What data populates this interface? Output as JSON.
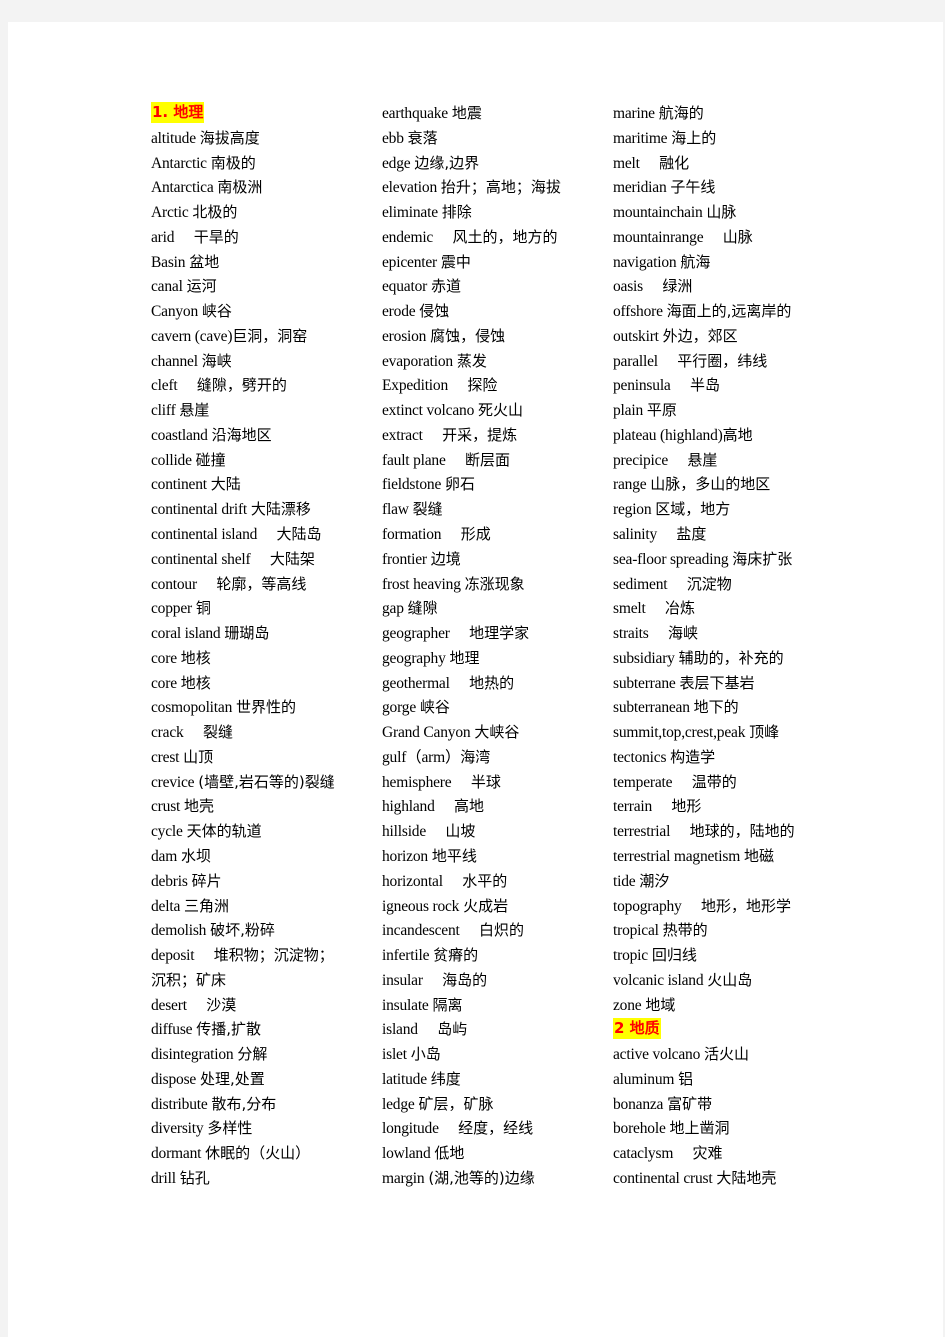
{
  "document": {
    "columns": [
      {
        "entries": [
          {
            "type": "heading",
            "text": "1.  地理"
          },
          {
            "en": "altitude",
            "zh": "海拔高度"
          },
          {
            "en": "Antarctic",
            "zh": "南极的"
          },
          {
            "en": "Antarctica",
            "zh": "南极洲"
          },
          {
            "en": "Arctic",
            "zh": "北极的"
          },
          {
            "en": "arid",
            "zh": "干旱的",
            "gap": true
          },
          {
            "en": "Basin",
            "zh": "盆地"
          },
          {
            "en": "canal",
            "zh": "运河"
          },
          {
            "en": "Canyon",
            "zh": "峡谷"
          },
          {
            "en": "cavern (cave)",
            "zh": "巨洞，洞窑",
            "tight": true
          },
          {
            "en": "channel",
            "zh": "海峡"
          },
          {
            "en": "cleft",
            "zh": "缝隙，劈开的",
            "gap": true
          },
          {
            "en": "cliff",
            "zh": "悬崖"
          },
          {
            "en": "coastland",
            "zh": "沿海地区"
          },
          {
            "en": "collide",
            "zh": "碰撞"
          },
          {
            "en": "continent",
            "zh": "大陆"
          },
          {
            "en": "continental  drift",
            "zh": "大陆漂移"
          },
          {
            "en": "continental  island",
            "zh": "大陆岛",
            "gap": true
          },
          {
            "en": "continental  shelf",
            "zh": "大陆架",
            "gap": true
          },
          {
            "en": "contour",
            "zh": "轮廓，等高线",
            "gap": true
          },
          {
            "en": "copper",
            "zh": "铜"
          },
          {
            "en": "coral  island",
            "zh": "珊瑚岛"
          },
          {
            "en": "core",
            "zh": "地核"
          },
          {
            "en": "core",
            "zh": "地核"
          },
          {
            "en": "cosmopolitan",
            "zh": "世界性的"
          },
          {
            "en": "crack",
            "zh": "裂缝",
            "gap": true
          },
          {
            "en": "crest",
            "zh": "山顶"
          },
          {
            "en": "crevice",
            "zh": "(墙壁,岩石等的)裂缝",
            "mini": true
          },
          {
            "en": "crust",
            "zh": "地壳"
          },
          {
            "en": "cycle",
            "zh": "天体的轨道"
          },
          {
            "en": "dam",
            "zh": "水坝"
          },
          {
            "en": "debris",
            "zh": "碎片"
          },
          {
            "en": "delta",
            "zh": "三角洲"
          },
          {
            "en": "demolish",
            "zh": "破坏,粉碎"
          },
          {
            "en": "deposit",
            "zh": "堆积物；沉淀物；",
            "gap": true
          },
          {
            "en": "",
            "zh": "沉积；矿床"
          },
          {
            "en": "desert",
            "zh": "沙漠",
            "gap": true
          },
          {
            "en": "diffuse",
            "zh": "传播,扩散"
          },
          {
            "en": "disintegration",
            "zh": "分解"
          },
          {
            "en": "dispose",
            "zh": "处理,处置"
          },
          {
            "en": "distribute",
            "zh": "散布,分布"
          },
          {
            "en": "diversity",
            "zh": "多样性"
          },
          {
            "en": "dormant",
            "zh": "休眠的（火山）"
          },
          {
            "en": "drill",
            "zh": "钻孔"
          }
        ]
      },
      {
        "entries": [
          {
            "en": "earthquake",
            "zh": "地震"
          },
          {
            "en": "ebb",
            "zh": "衰落"
          },
          {
            "en": "edge",
            "zh": "边缘,边界"
          },
          {
            "en": "elevation",
            "zh": "抬升；高地；海拔"
          },
          {
            "en": "eliminate",
            "zh": "排除"
          },
          {
            "en": "endemic",
            "zh": "风土的，地方的",
            "gap": true
          },
          {
            "en": "epicenter",
            "zh": "震中"
          },
          {
            "en": "equator",
            "zh": "赤道"
          },
          {
            "en": "erode",
            "zh": "侵蚀"
          },
          {
            "en": "erosion",
            "zh": "腐蚀，侵蚀"
          },
          {
            "en": "evaporation",
            "zh": "蒸发"
          },
          {
            "en": "Expedition",
            "zh": "探险",
            "gap": true
          },
          {
            "en": "extinct  volcano",
            "zh": "死火山"
          },
          {
            "en": "extract",
            "zh": "开采，提炼",
            "gap": true
          },
          {
            "en": "fault  plane",
            "zh": "断层面",
            "gap": true
          },
          {
            "en": "fieldstone",
            "zh": "卵石"
          },
          {
            "en": "flaw",
            "zh": "裂缝"
          },
          {
            "en": "formation",
            "zh": "形成",
            "gap": true
          },
          {
            "en": "frontier",
            "zh": "边境"
          },
          {
            "en": "frost  heaving",
            "zh": "冻涨现象"
          },
          {
            "en": "gap",
            "zh": "缝隙"
          },
          {
            "en": "geographer",
            "zh": "地理学家",
            "gap": true
          },
          {
            "en": "geography",
            "zh": "地理"
          },
          {
            "en": "geothermal",
            "zh": "地热的",
            "gap": true
          },
          {
            "en": "gorge",
            "zh": "峡谷"
          },
          {
            "en": "Grand  Canyon",
            "zh": "大峡谷"
          },
          {
            "en": "gulf（arm）",
            "zh": "海湾",
            "tight": true
          },
          {
            "en": "hemisphere",
            "zh": "半球",
            "gap": true
          },
          {
            "en": "highland",
            "zh": "高地",
            "gap": true
          },
          {
            "en": "hillside",
            "zh": "山坡",
            "gap": true
          },
          {
            "en": "horizon",
            "zh": "地平线"
          },
          {
            "en": "horizontal",
            "zh": "水平的",
            "gap": true
          },
          {
            "en": "igneous  rock",
            "zh": "火成岩"
          },
          {
            "en": "incandescent",
            "zh": "白炽的",
            "gap": true
          },
          {
            "en": "infertile",
            "zh": "贫瘠的"
          },
          {
            "en": "insular",
            "zh": "海岛的",
            "gap": true
          },
          {
            "en": "insulate",
            "zh": "隔离"
          },
          {
            "en": "island",
            "zh": "岛屿",
            "gap": true
          },
          {
            "en": "islet",
            "zh": "小岛"
          },
          {
            "en": "latitude",
            "zh": "纬度"
          },
          {
            "en": "ledge",
            "zh": "矿层，矿脉"
          },
          {
            "en": "longitude",
            "zh": "经度，经线",
            "gap": true
          },
          {
            "en": "lowland",
            "zh": "低地"
          },
          {
            "en": "margin",
            "zh": "(湖,池等的)边缘",
            "mini": true
          }
        ]
      },
      {
        "entries": [
          {
            "en": "marine",
            "zh": "航海的"
          },
          {
            "en": "maritime",
            "zh": "海上的"
          },
          {
            "en": "melt",
            "zh": "融化",
            "gap": true
          },
          {
            "en": "meridian",
            "zh": "子午线"
          },
          {
            "en": "mountainchain",
            "zh": "山脉"
          },
          {
            "en": "mountainrange",
            "zh": "山脉",
            "gap": true
          },
          {
            "en": "navigation",
            "zh": "航海"
          },
          {
            "en": "oasis",
            "zh": "绿洲",
            "gap": true
          },
          {
            "en": "offshore",
            "zh": "海面上的,远离岸的"
          },
          {
            "en": "outskirt",
            "zh": "外边，郊区"
          },
          {
            "en": "parallel",
            "zh": "平行圈，纬线",
            "gap": true
          },
          {
            "en": "peninsula",
            "zh": "半岛",
            "gap": true
          },
          {
            "en": "plain",
            "zh": "平原"
          },
          {
            "en": "plateau  (highland)",
            "zh": "高地",
            "tight": true
          },
          {
            "en": "precipice",
            "zh": "悬崖",
            "gap": true
          },
          {
            "en": "range",
            "zh": "山脉，多山的地区"
          },
          {
            "en": "region",
            "zh": "区域，地方"
          },
          {
            "en": "salinity",
            "zh": "盐度",
            "gap": true
          },
          {
            "en": "sea-floor  spreading",
            "zh": "海床扩张"
          },
          {
            "en": "sediment",
            "zh": "沉淀物",
            "gap": true
          },
          {
            "en": "smelt",
            "zh": "冶炼",
            "gap": true
          },
          {
            "en": "straits",
            "zh": "海峡",
            "gap": true
          },
          {
            "en": "subsidiary",
            "zh": "辅助的，补充的"
          },
          {
            "en": "subterrane",
            "zh": "表层下基岩"
          },
          {
            "en": "subterranean",
            "zh": "地下的"
          },
          {
            "en": "summit,top,crest,peak",
            "zh": "顶峰"
          },
          {
            "en": "tectonics",
            "zh": "构造学"
          },
          {
            "en": "temperate",
            "zh": "温带的",
            "gap": true
          },
          {
            "en": "terrain",
            "zh": "地形",
            "gap": true
          },
          {
            "en": "terrestrial",
            "zh": "地球的，陆地的",
            "gap": true
          },
          {
            "en": "terrestrial  magnetism",
            "zh": "地磁"
          },
          {
            "en": "tide",
            "zh": "潮汐"
          },
          {
            "en": "topography",
            "zh": "地形，地形学",
            "gap": true
          },
          {
            "en": "tropical",
            "zh": "热带的"
          },
          {
            "en": "tropic",
            "zh": "回归线"
          },
          {
            "en": "volcanic  island",
            "zh": "火山岛"
          },
          {
            "en": "zone",
            "zh": "地域"
          },
          {
            "type": "heading",
            "text": "2 地质"
          },
          {
            "en": "active  volcano",
            "zh": "活火山"
          },
          {
            "en": "aluminum",
            "zh": "铝"
          },
          {
            "en": "bonanza",
            "zh": "富矿带"
          },
          {
            "en": "borehole",
            "zh": "地上凿洞"
          },
          {
            "en": "cataclysm",
            "zh": "灾难",
            "gap": true
          },
          {
            "en": "continental  crust",
            "zh": "大陆地壳"
          }
        ]
      }
    ]
  },
  "colors": {
    "heading_text": "#ff0000",
    "heading_highlight": "#ffff00",
    "page_background": "#ffffff",
    "canvas_background": "#f3f3f3"
  }
}
